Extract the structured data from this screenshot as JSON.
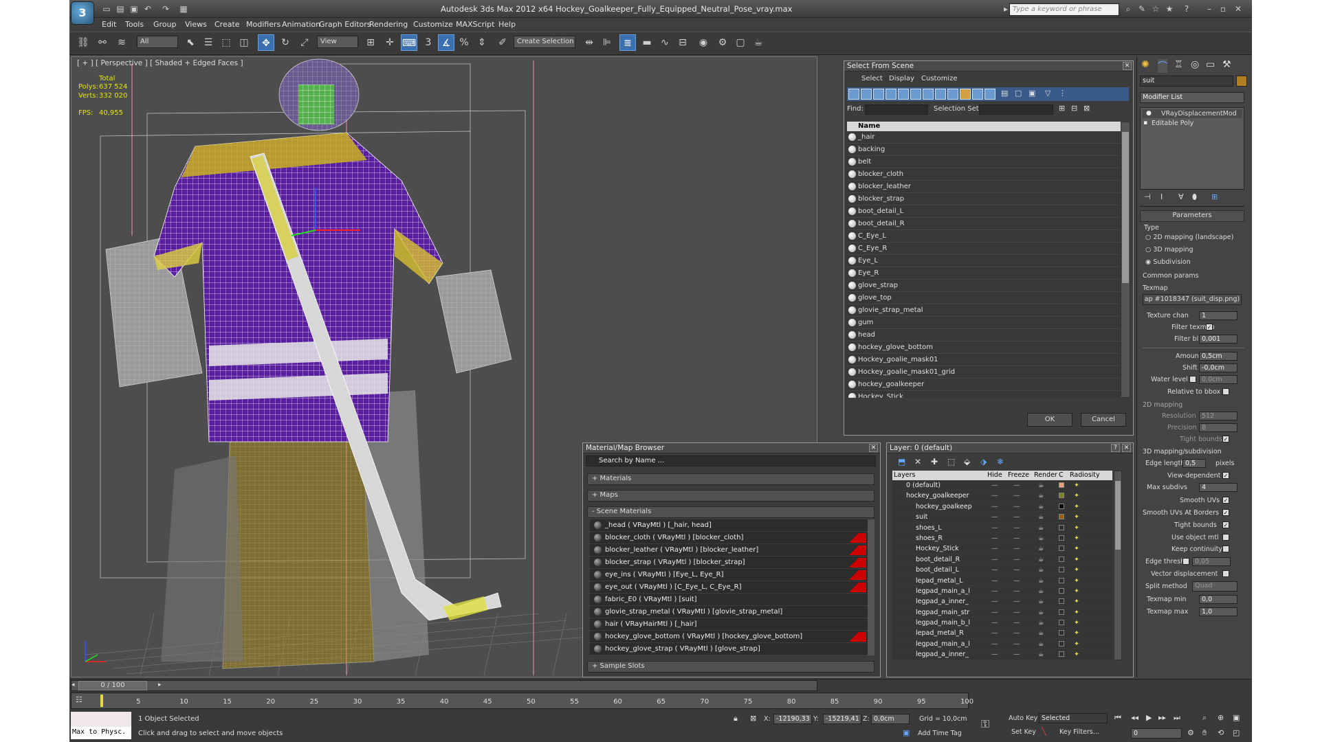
{
  "window": {
    "logo": "3",
    "title": "Autodesk 3ds Max  2012 x64     Hockey_Goalkeeper_Fully_Equipped_Neutral_Pose_vray.max",
    "search_placeholder": "Type a keyword or phrase"
  },
  "menus": [
    "Edit",
    "Tools",
    "Group",
    "Views",
    "Create",
    "Modifiers",
    "Animation",
    "Graph Editors",
    "Rendering",
    "Customize",
    "MAXScript",
    "Help"
  ],
  "toolbar": {
    "filter_value": "All",
    "ref_coord": "View",
    "named_selection": "Create Selection Se"
  },
  "viewport": {
    "label": "[ + ] [ Perspective ] [ Shaded + Edged Faces ]",
    "stats_total": "Total",
    "polys_label": "Polys:",
    "polys_value": "637 524",
    "verts_label": "Verts:",
    "verts_value": "332 020",
    "fps_label": "FPS:",
    "fps_value": "40,955"
  },
  "select_from_scene": {
    "title": "Select From Scene",
    "menus": [
      "Select",
      "Display",
      "Customize"
    ],
    "find_label": "Find:",
    "selset_label": "Selection Set:",
    "col_name": "Name",
    "items": [
      "_hair",
      "backing",
      "belt",
      "blocker_cloth",
      "blocker_leather",
      "blocker_strap",
      "boot_detail_L",
      "boot_detail_R",
      "C_Eye_L",
      "C_Eye_R",
      "Eye_L",
      "Eye_R",
      "glove_strap",
      "glove_top",
      "glovie_strap_metal",
      "gum",
      "head",
      "hockey_glove_bottom",
      "Hockey_goalie_mask01",
      "Hockey_goalie_mask01_grid",
      "hockey_goalkeeper",
      "Hockey_Stick"
    ],
    "ok_label": "OK",
    "cancel_label": "Cancel"
  },
  "material_browser": {
    "title": "Material/Map Browser",
    "search_placeholder": "Search by Name ...",
    "sec_materials": "+ Materials",
    "sec_maps": "+ Maps",
    "sec_scene": "- Scene Materials",
    "sec_sample": "+ Sample Slots",
    "items": [
      {
        "text": "_head  ( VRayMtl )  [_hair, head]",
        "red": false
      },
      {
        "text": "blocker_cloth  ( VRayMtl )  [blocker_cloth]",
        "red": true
      },
      {
        "text": "blocker_leather  ( VRayMtl )  [blocker_leather]",
        "red": true
      },
      {
        "text": "blocker_strap  ( VRayMtl )  [blocker_strap]",
        "red": true
      },
      {
        "text": "eye_ins  ( VRayMtl )  [Eye_L, Eye_R]",
        "red": true
      },
      {
        "text": "eye_out  ( VRayMtl )  [C_Eye_L, C_Eye_R]",
        "red": true
      },
      {
        "text": "fabric_E0  ( VRayMtl )  [suit]",
        "red": false
      },
      {
        "text": "glovie_strap_metal  ( VRayMtl )  [glovie_strap_metal]",
        "red": false
      },
      {
        "text": "hair  ( VRayHairMtl )  [_hair]",
        "red": false
      },
      {
        "text": "hockey_glove_bottom  ( VRayMtl )  [hockey_glove_bottom]",
        "red": true
      },
      {
        "text": "hockey_glove_strap  ( VRayMtl )  [glove_strap]",
        "red": false
      }
    ]
  },
  "layer_dialog": {
    "title": "Layer: 0 (default)",
    "help": "?",
    "cols": {
      "layers": "Layers",
      "hide": "Hide",
      "freeze": "Freeze",
      "render": "Render",
      "c": "C",
      "radiosity": "Radiosity"
    },
    "rows": [
      {
        "name": "0 (default)",
        "indent": 1,
        "color": "#e8a080"
      },
      {
        "name": "hockey_goalkeeper",
        "indent": 1,
        "color": "#808020"
      },
      {
        "name": "hockey_goalkeep",
        "indent": 2,
        "color": "#000000"
      },
      {
        "name": "suit",
        "indent": 2,
        "color": "#a06000"
      },
      {
        "name": "shoes_L",
        "indent": 2,
        "color": "#303030"
      },
      {
        "name": "shoes_R",
        "indent": 2,
        "color": "#303030"
      },
      {
        "name": "Hockey_Stick",
        "indent": 2,
        "color": "#303030"
      },
      {
        "name": "boot_detail_R",
        "indent": 2,
        "color": "#303030"
      },
      {
        "name": "boot_detail_L",
        "indent": 2,
        "color": "#303030"
      },
      {
        "name": "lepad_metal_L",
        "indent": 2,
        "color": "#303030"
      },
      {
        "name": "legpad_main_a_l",
        "indent": 2,
        "color": "#303030"
      },
      {
        "name": "legpad_a_inner_",
        "indent": 2,
        "color": "#303030"
      },
      {
        "name": "legpad_main_str",
        "indent": 2,
        "color": "#303030"
      },
      {
        "name": "legpad_main_b_l",
        "indent": 2,
        "color": "#303030"
      },
      {
        "name": "lepad_metal_R",
        "indent": 2,
        "color": "#303030"
      },
      {
        "name": "legpad_main_a_l",
        "indent": 2,
        "color": "#303030"
      },
      {
        "name": "legpad_a_inner_",
        "indent": 2,
        "color": "#303030"
      }
    ]
  },
  "command_panel": {
    "object_name": "suit",
    "modifier_list": "Modifier List",
    "stack": [
      "VRayDisplacementMod",
      "Editable Poly"
    ],
    "params_title": "Parameters",
    "type_label": "Type",
    "type_2d": "2D mapping (landscape)",
    "type_3d": "3D mapping",
    "type_sub": "Subdivision",
    "common_label": "Common params",
    "texmap_label": "Texmap",
    "texmap_value": "ap #1018347 (suit_disp.png)",
    "texchan_label": "Texture chan",
    "texchan_value": "1",
    "filter_texmap": "Filter texmap",
    "filter_blur_label": "Filter blur",
    "filter_blur_value": "0,001",
    "amount_label": "Amount",
    "amount_value": "0,5cm",
    "shift_label": "Shift",
    "shift_value": "-0,0cm",
    "water_label": "Water level",
    "water_value": "0,0cm",
    "relative": "Relative to bbox",
    "map2d_label": "2D mapping",
    "resolution_label": "Resolution",
    "resolution_value": "512",
    "precision_label": "Precision",
    "precision_value": "8",
    "tight1": "Tight bounds",
    "map3d_label": "3D mapping/subdivision",
    "edge_len_label": "Edge length",
    "edge_len_value": "0,5",
    "pixels": "pixels",
    "view_dep": "View-dependent",
    "max_sub_label": "Max subdivs",
    "max_sub_value": "4",
    "smooth_uv": "Smooth UVs",
    "smooth_uv_borders": "Smooth UVs At Borders",
    "tight2": "Tight bounds",
    "use_obj_mtl": "Use object mtl",
    "keep_cont": "Keep continuity",
    "edge_thresh_label": "Edge thresh",
    "edge_thresh_value": "0,05",
    "vector_disp": "Vector displacement",
    "split_label": "Split method",
    "split_value": "Quad",
    "texmin_label": "Texmap min",
    "texmin_value": "0,0",
    "texmax_label": "Texmap max",
    "texmax_value": "1,0"
  },
  "timeline": {
    "frame": "0 / 100",
    "ticks": [
      "5",
      "10",
      "15",
      "20",
      "25",
      "30",
      "35",
      "40",
      "45",
      "50",
      "55",
      "60",
      "65",
      "70",
      "75",
      "80",
      "85",
      "90",
      "95",
      "100"
    ]
  },
  "status": {
    "maxscript": "Max to Physc.",
    "selected": "1 Object Selected",
    "prompt": "Click and drag to select and move objects",
    "x_label": "X:",
    "x_value": "-12190,33",
    "y_label": "Y:",
    "y_value": "-15219,41",
    "z_label": "Z:",
    "z_value": "0,0cm",
    "grid": "Grid = 10,0cm",
    "add_time_tag": "Add Time Tag",
    "auto_key": "Auto Key",
    "selected_dd": "Selected",
    "set_key": "Set Key",
    "key_filters": "Key Filters...",
    "frame_value": "0"
  }
}
